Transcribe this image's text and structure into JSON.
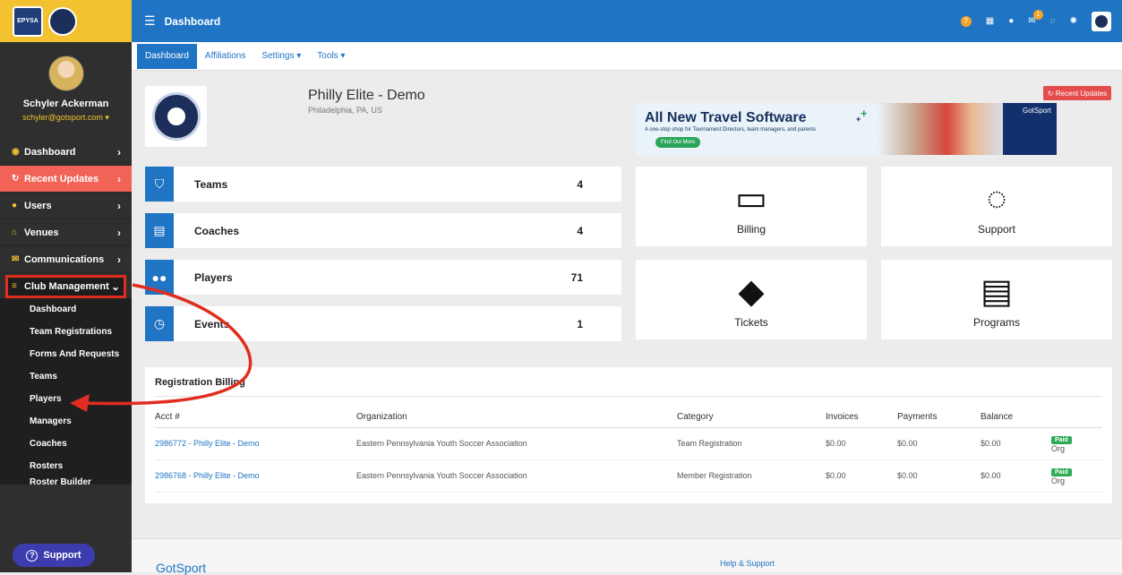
{
  "sidebar": {
    "logo_text": "EASTERN PENNSYLVANIA",
    "user_name": "Schyler Ackerman",
    "user_email": "schyler@gotsport.com ▾",
    "items": [
      {
        "label": "Dashboard",
        "icon": "dashboard-icon"
      },
      {
        "label": "Recent Updates",
        "icon": "refresh-icon"
      },
      {
        "label": "Users",
        "icon": "users-icon"
      },
      {
        "label": "Venues",
        "icon": "venue-icon"
      },
      {
        "label": "Communications",
        "icon": "chat-icon"
      },
      {
        "label": "Club Management",
        "icon": "list-icon"
      }
    ],
    "sub_items": [
      "Dashboard",
      "Team Registrations",
      "Forms And Requests",
      "Teams",
      "Players",
      "Managers",
      "Coaches",
      "Rosters",
      "Roster Builder"
    ],
    "support_label": "Support"
  },
  "topbar": {
    "title": "Dashboard",
    "mail_count": "1"
  },
  "tabs": [
    {
      "label": "Dashboard"
    },
    {
      "label": "Affiliations"
    },
    {
      "label": "Settings ▾"
    },
    {
      "label": "Tools ▾"
    }
  ],
  "club": {
    "name": "Philly Elite - Demo",
    "location": "Philadelphia, PA, US",
    "recent_updates": "↻ Recent Updates"
  },
  "ad": {
    "title": "All New Travel Software",
    "subtitle": "A one-stop shop for Tournament Directors, team managers, and parents",
    "button": "Find Out More",
    "brand": "GotSport"
  },
  "stats": [
    {
      "label": "Teams",
      "value": "4",
      "icon": "shield-icon"
    },
    {
      "label": "Coaches",
      "value": "4",
      "icon": "clipboard-icon"
    },
    {
      "label": "Players",
      "value": "71",
      "icon": "players-icon"
    },
    {
      "label": "Events",
      "value": "1",
      "icon": "clock-icon"
    }
  ],
  "tiles": [
    {
      "label": "Billing",
      "icon": "credit-card-icon"
    },
    {
      "label": "Support",
      "icon": "chat-bubbles-icon"
    },
    {
      "label": "Tickets",
      "icon": "ticket-icon"
    },
    {
      "label": "Programs",
      "icon": "document-icon"
    }
  ],
  "registration": {
    "title": "Registration Billing",
    "columns": [
      "Acct #",
      "Organization",
      "Category",
      "Invoices",
      "Payments",
      "Balance",
      ""
    ],
    "rows": [
      {
        "acct": "2986772 - Philly Elite - Demo",
        "org": "Eastern Pennsylvania Youth Soccer Association",
        "category": "Team Registration",
        "invoices": "$0.00",
        "payments": "$0.00",
        "balance": "$0.00",
        "status": "Paid",
        "type": "Org"
      },
      {
        "acct": "2986768 - Philly Elite - Demo",
        "org": "Eastern Pennsylvania Youth Soccer Association",
        "category": "Member Registration",
        "invoices": "$0.00",
        "payments": "$0.00",
        "balance": "$0.00",
        "status": "Paid",
        "type": "Org"
      }
    ]
  },
  "footer": {
    "logo": "GotSport",
    "help": "Help & Support"
  },
  "colors": {
    "primary": "#1f74c4",
    "sidebar": "#2f2f2f",
    "accent_yellow": "#f2c230",
    "alert_red": "#f16257",
    "annotation_red": "#e02d1f",
    "paid_green": "#2eaa55"
  }
}
